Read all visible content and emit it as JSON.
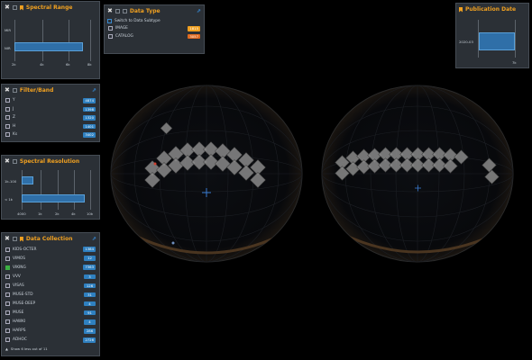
{
  "spectral_range": {
    "title": "Spectral Range",
    "bars": [
      {
        "label": "MIR",
        "value": 0
      },
      {
        "label": "NIR",
        "value": 6.8
      }
    ],
    "ticks": [
      "2k",
      "4k",
      "6k",
      "8k"
    ]
  },
  "data_type": {
    "title": "Data Type",
    "switch_label": "Switch to Data Subtype",
    "items": [
      {
        "label": "IMAGE",
        "count": "1815",
        "color": "#f0a020"
      },
      {
        "label": "CATALOG",
        "count": "3057",
        "color": "#e06a20"
      }
    ]
  },
  "publication_date": {
    "title": "Publication Date",
    "bar_label": "2020-03",
    "tick": "7k",
    "value": 0.95
  },
  "filter_band": {
    "title": "Filter/Band",
    "items": [
      {
        "label": "Y",
        "count": "4874"
      },
      {
        "label": "J",
        "count": "1398"
      },
      {
        "label": "Z",
        "count": "1320"
      },
      {
        "label": "H",
        "count": "1401"
      },
      {
        "label": "Ks",
        "count": "3402"
      }
    ]
  },
  "spectral_resolution": {
    "title": "Spectral Resolution",
    "bars": [
      {
        "label": "1k-100",
        "value": 1.1
      },
      {
        "label": "< 1k",
        "value": 8.8
      }
    ],
    "ticks": [
      "4000",
      "1k",
      "2k",
      "4k",
      "10k"
    ]
  },
  "data_collection": {
    "title": "Data Collection",
    "items": [
      {
        "label": "KIDS-OCTER",
        "count": "1384",
        "checked": false
      },
      {
        "label": "VIMOS",
        "count": "12",
        "checked": false
      },
      {
        "label": "VIKING",
        "count": "7363",
        "checked": true
      },
      {
        "label": "VVV",
        "count": "3",
        "checked": false
      },
      {
        "label": "VISAS",
        "count": "126",
        "checked": false
      },
      {
        "label": "MUSE-STD",
        "count": "31",
        "checked": false
      },
      {
        "label": "MUSE-DEEP",
        "count": "4",
        "checked": false
      },
      {
        "label": "MUSE",
        "count": "91",
        "checked": false
      },
      {
        "label": "HAWKI",
        "count": "4",
        "checked": false
      },
      {
        "label": "HARPS",
        "count": "286",
        "checked": false
      },
      {
        "label": "ADHOC",
        "count": "2726",
        "checked": false
      }
    ],
    "footer": "Show 6 less out of 11"
  },
  "colors": {
    "accent": "#f0a020",
    "bar": "#2f6fa8",
    "badge": "#2f80c0",
    "checked": "#3cb043"
  }
}
